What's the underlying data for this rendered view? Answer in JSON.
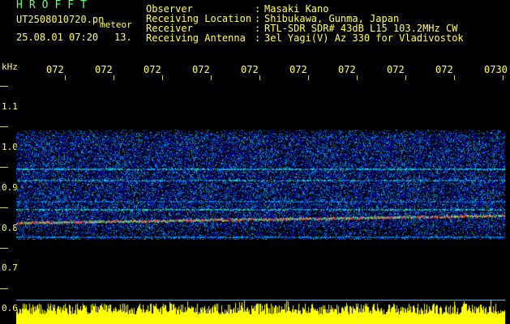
{
  "app_title": "HROFFT",
  "file": {
    "name": "UT2508010720.pn",
    "suffix": "meteor",
    "datetime": "25.08.01 07:20",
    "count": "13."
  },
  "header": [
    {
      "label": "Observer",
      "colon": ":",
      "value": "Masaki Kano"
    },
    {
      "label": "Receiving Location",
      "colon": ":",
      "value": "Shibukawa, Gunma, Japan"
    },
    {
      "label": "Receiver",
      "colon": ":",
      "value": "RTL-SDR SDR# 43dB L15 103.2MHz CW"
    },
    {
      "label": "Receiving Antenna",
      "colon": ":",
      "value": "3el Yagi(V) Az 330 for Vladivostok"
    }
  ],
  "axis": {
    "y_unit": "kHz",
    "y_labels": [
      "1.1",
      "1.0",
      "0.9",
      "0.8",
      "0.7",
      "0.6"
    ],
    "x_labels": [
      "072",
      "072",
      "072",
      "072",
      "072",
      "072",
      "072",
      "072",
      "072",
      "0730"
    ]
  },
  "colors": {
    "text": "#ffff66",
    "title": "#6dff6d",
    "background": "#000000",
    "activity": "#ffff00"
  }
}
